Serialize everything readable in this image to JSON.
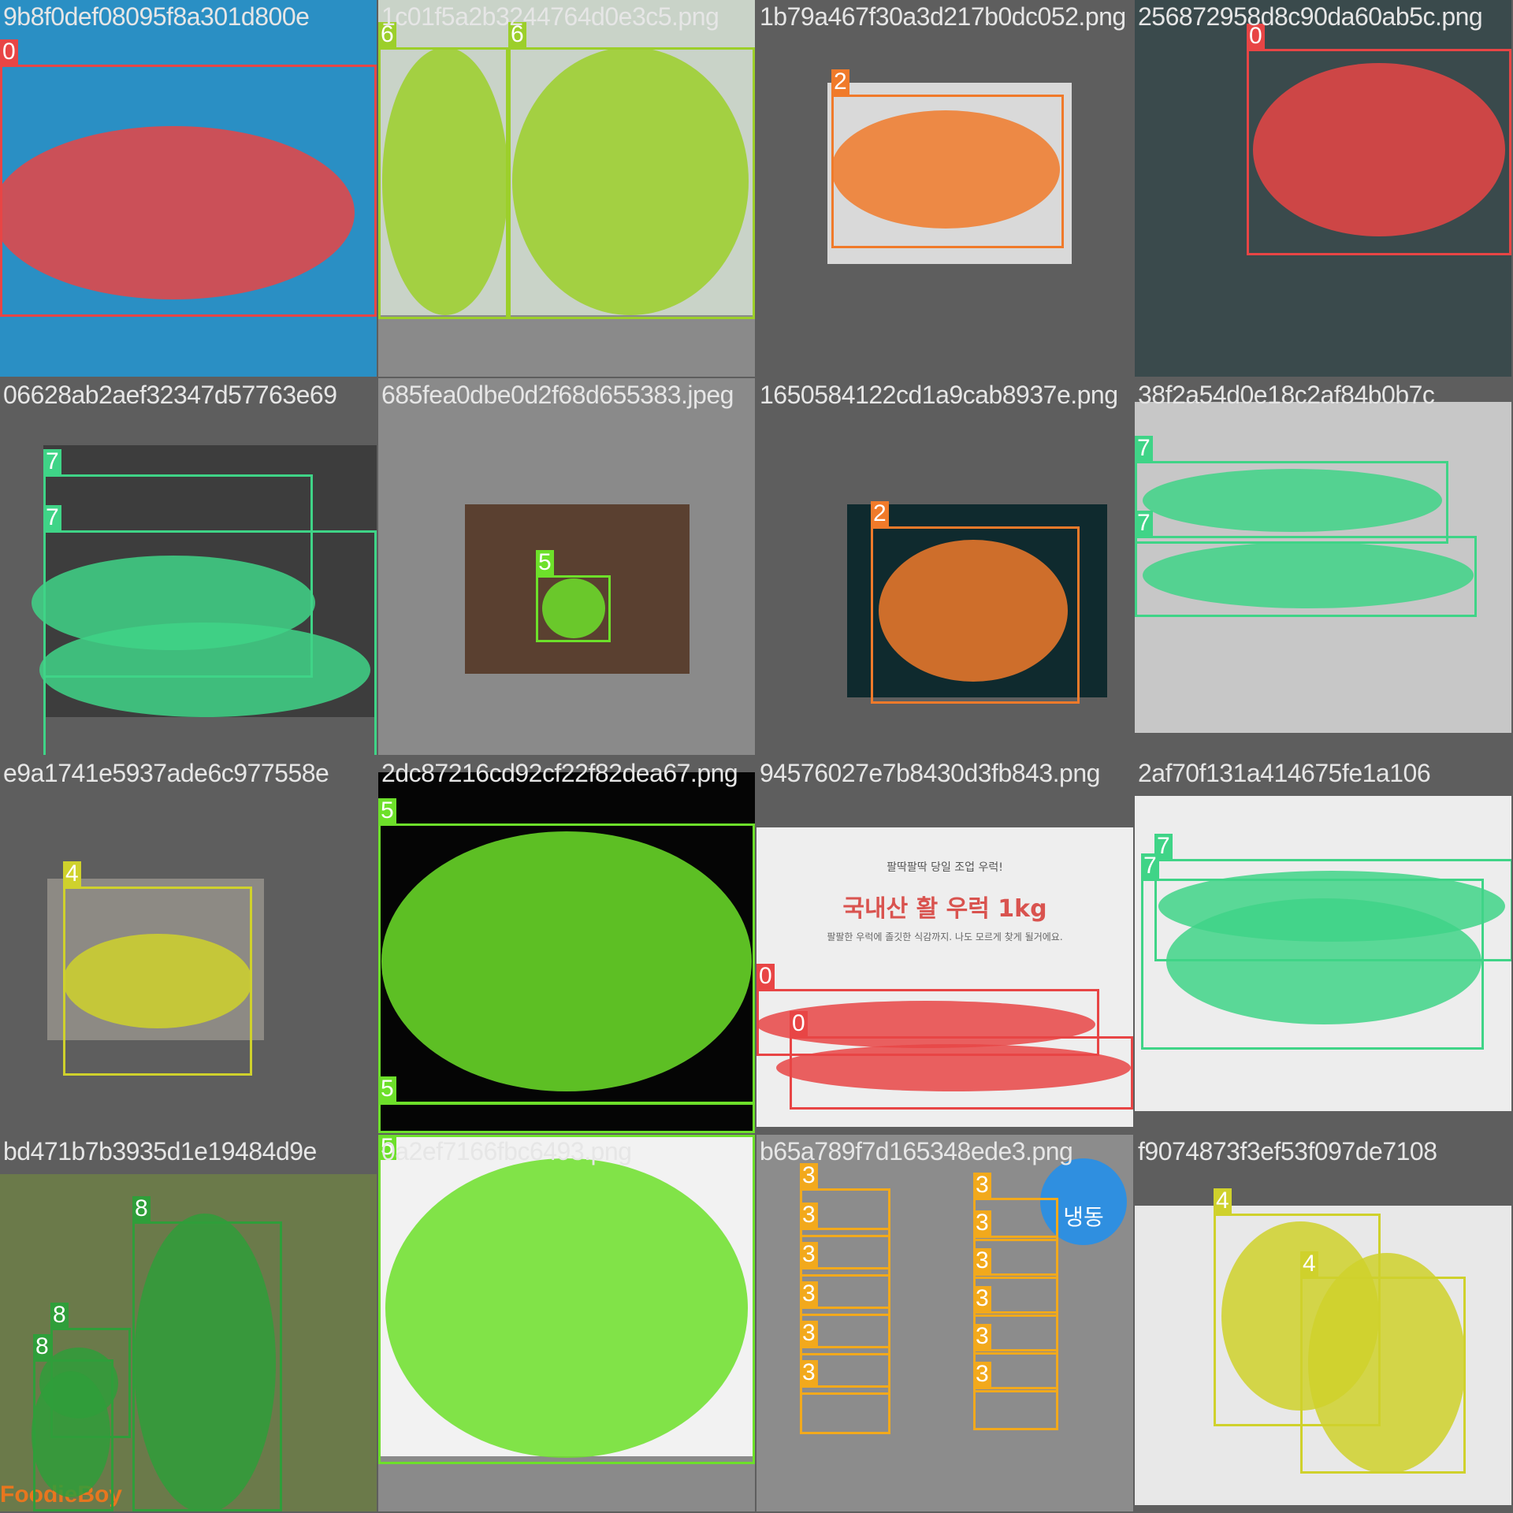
{
  "classes": {
    "0": {
      "color": "#e84545"
    },
    "2": {
      "color": "#f07a2a"
    },
    "3": {
      "color": "#f2a91c"
    },
    "4": {
      "color": "#cfd12c"
    },
    "5": {
      "color": "#6de02a"
    },
    "6": {
      "color": "#9ccf2a"
    },
    "7": {
      "color": "#3fd487"
    },
    "8": {
      "color": "#2f9e3a"
    }
  },
  "tiles": [
    {
      "filename": "9b8f0def08095f8a301d800e",
      "labels": [
        "0"
      ]
    },
    {
      "filename": "1c01f5a2b3244764d0e3c5.png",
      "labels": [
        "6",
        "6"
      ]
    },
    {
      "filename": "1b79a467f30a3d217b0dc052.png",
      "labels": [
        "2"
      ]
    },
    {
      "filename": "256872958d8c90da60ab5c.png",
      "labels": [
        "0"
      ]
    },
    {
      "filename": "06628ab2aef32347d57763e69",
      "labels": [
        "7",
        "7"
      ]
    },
    {
      "filename": "685fea0dbe0d2f68d655383.jpeg",
      "labels": [
        "5"
      ]
    },
    {
      "filename": "1650584122cd1a9cab8937e.png",
      "labels": [
        "2"
      ]
    },
    {
      "filename": "38f2a54d0e18c2af84b0b7c",
      "labels": [
        "7",
        "7"
      ]
    },
    {
      "filename": "e9a1741e5937ade6c977558e",
      "labels": [
        "4"
      ]
    },
    {
      "filename": "2dc87216cd92cf22f82dea67.png",
      "labels": [
        "5",
        "5"
      ]
    },
    {
      "filename": "94576027e7b8430d3fb843.png",
      "labels": [
        "0",
        "0"
      ]
    },
    {
      "filename": "2af70f131a414675fe1a106",
      "labels": [
        "7",
        "7"
      ]
    },
    {
      "filename": "bd471b7b3935d1e19484d9e",
      "labels": [
        "8",
        "8",
        "8"
      ]
    },
    {
      "filename": "0a2ef7166fbc6493.png",
      "labels": [
        "5"
      ]
    },
    {
      "filename": "b65a789f7d165348ede3.png",
      "labels": [
        "3",
        "3",
        "3",
        "3",
        "3",
        "3",
        "3",
        "3",
        "3",
        "3",
        "3",
        "3"
      ]
    },
    {
      "filename": "f9074873f3ef53f097de7108",
      "labels": [
        "4",
        "4"
      ]
    }
  ],
  "poster_text": {
    "line1": "팔딱팔딱 당일 조업 우럭!",
    "headline": "국내산 활 우럭 1kg",
    "line2": "팔팔한 우럭에 졸깃한 식감까지. 나도 모르게 찾게 될거에요."
  },
  "badge_text": "냉동",
  "brand_text": "FoodieBoy"
}
